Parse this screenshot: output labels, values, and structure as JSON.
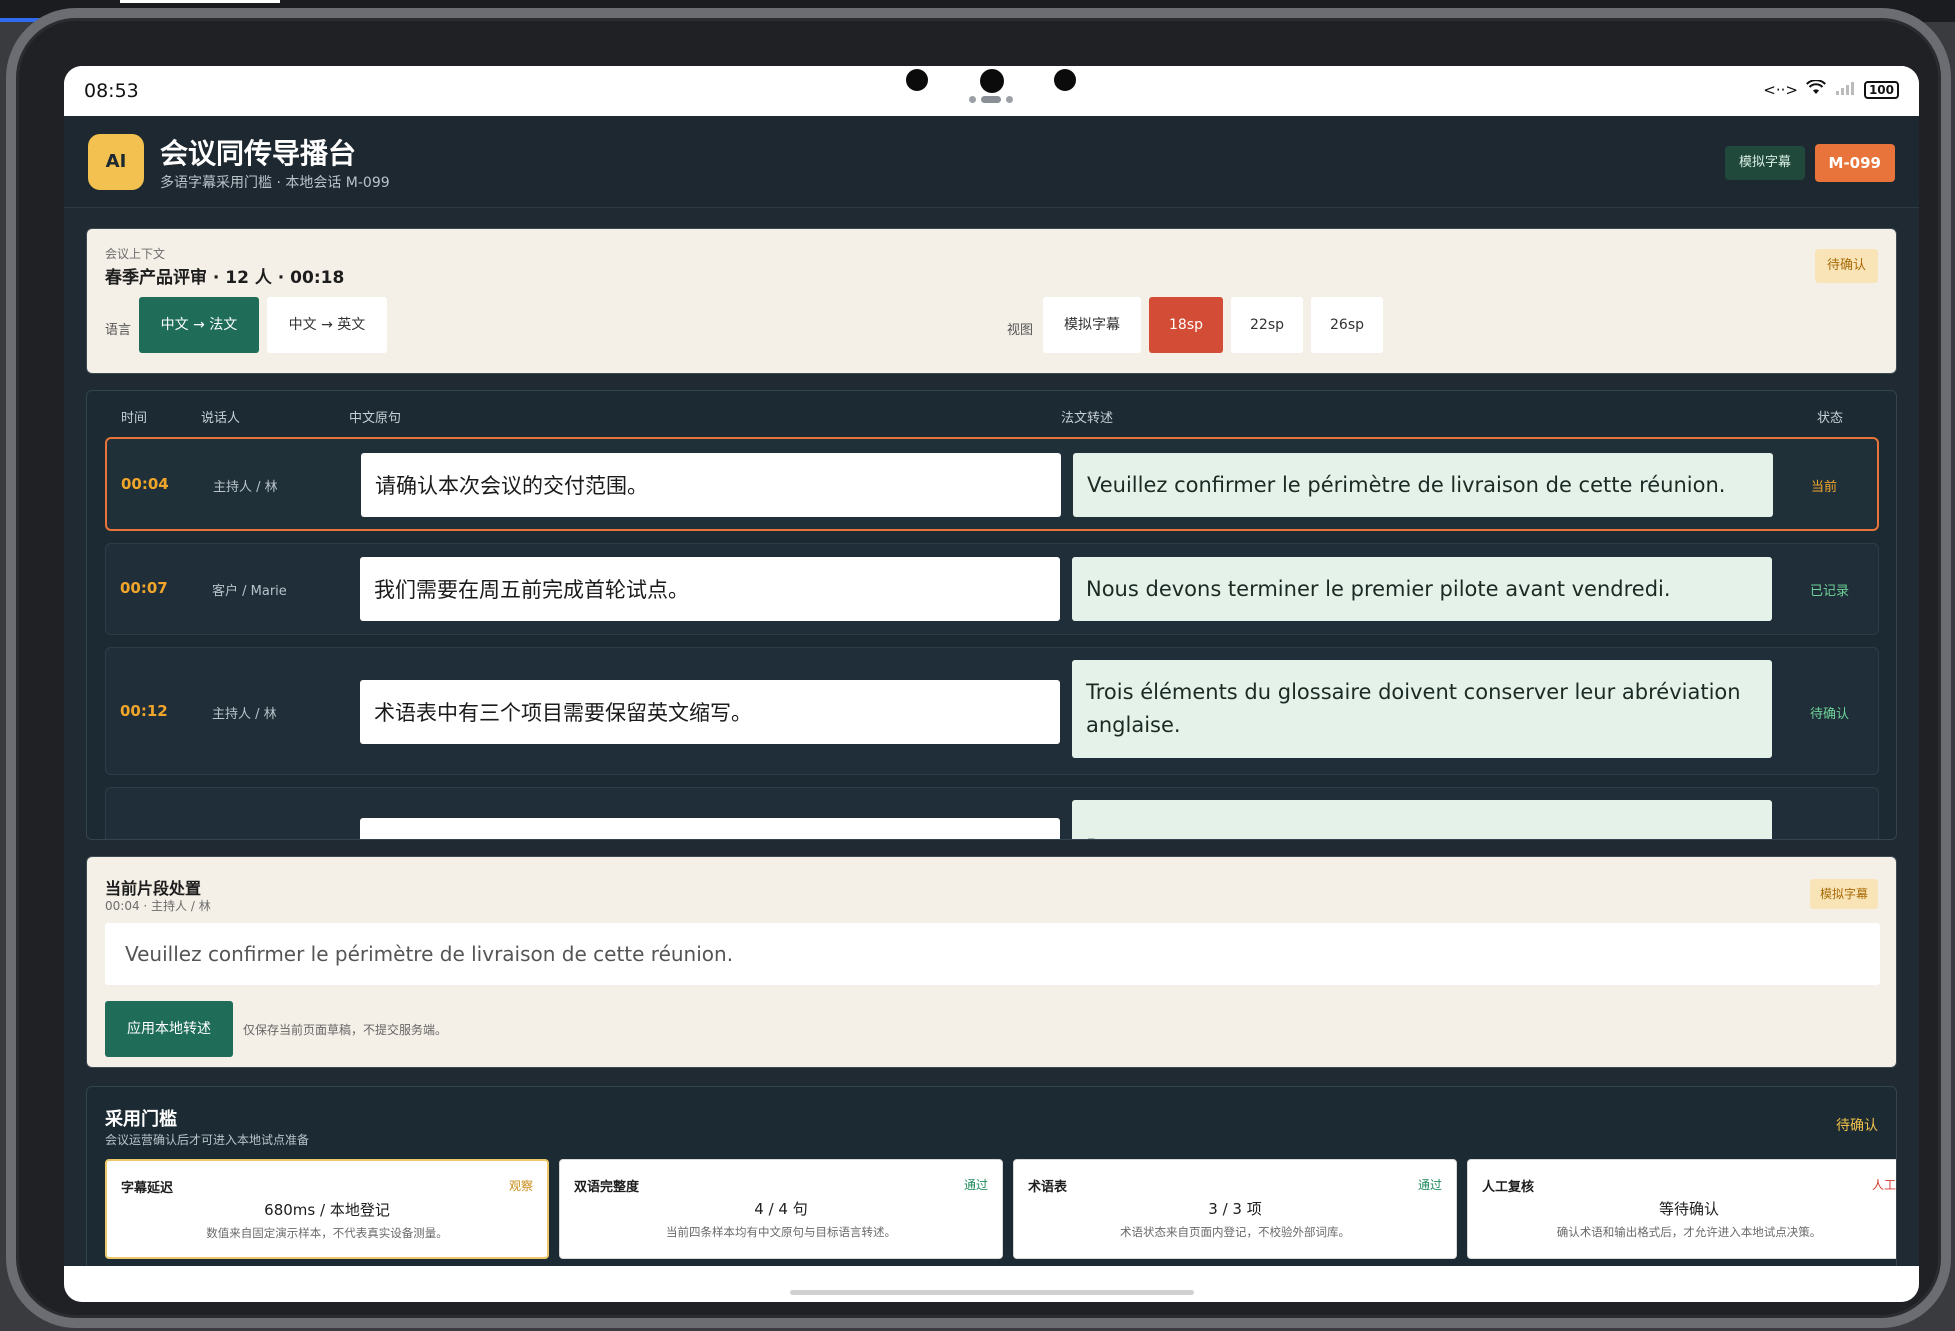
{
  "status": {
    "time": "08:53",
    "network": "<··>",
    "wifi": "wifi-icon",
    "signal": "signal-icon",
    "battery": "100"
  },
  "header": {
    "logo": "AI",
    "title": "会议同传导播台",
    "subtitle": "多语字幕采用门槛 · 本地会话 M-099",
    "badge_sim": "模拟字幕",
    "badge_id": "M-099"
  },
  "context": {
    "small_label": "会议上下文",
    "title": "春季产品评审 · 12 人 · 00:18",
    "pending": "待确认",
    "lang_label": "语言",
    "lang_options": [
      "中文 → 法文",
      "中文 → 英文"
    ],
    "lang_selected": "中文 → 法文",
    "view_label": "视图",
    "view_options": [
      "模拟字幕",
      "18sp",
      "22sp",
      "26sp"
    ],
    "view_selected": "18sp"
  },
  "table": {
    "headers": [
      "时间",
      "说话人",
      "中文原句",
      "法文转述",
      "状态"
    ],
    "rows": [
      {
        "time": "00:04",
        "speaker": "主持人 / 林",
        "zh": "请确认本次会议的交付范围。",
        "fr": "Veuillez confirmer le périmètre de livraison de cette réunion.",
        "status": "当前"
      },
      {
        "time": "00:07",
        "speaker": "客户 / Marie",
        "zh": "我们需要在周五前完成首轮试点。",
        "fr": "Nous devons terminer le premier pilote avant vendredi.",
        "status": "已记录"
      },
      {
        "time": "00:12",
        "speaker": "主持人 / 林",
        "zh": "术语表中有三个项目需要保留英文缩写。",
        "fr": "Trois éléments du glossaire doivent conserver leur abréviation anglaise.",
        "status": "待确认"
      },
      {
        "time": "",
        "speaker": "",
        "zh": "",
        "fr": "P…",
        "status": ""
      }
    ]
  },
  "segment": {
    "title": "当前片段处置",
    "meta": "00:04 · 主持人 / 林",
    "badge": "模拟字幕",
    "field_value": "Veuillez confirmer le périmètre de livraison de cette réunion.",
    "apply_label": "应用本地转述",
    "note": "仅保存当前页面草稿，不提交服务端。"
  },
  "gate": {
    "title": "采用门槛",
    "subtitle": "会议运营确认后才可进入本地试点准备",
    "pending": "待确认",
    "items": [
      {
        "name": "字幕延迟",
        "state": "观察",
        "value": "680ms / 本地登记",
        "desc": "数值来自固定演示样本，不代表真实设备测量。"
      },
      {
        "name": "双语完整度",
        "state": "通过",
        "value": "4 / 4 句",
        "desc": "当前四条样本均有中文原句与目标语言转述。"
      },
      {
        "name": "术语表",
        "state": "通过",
        "value": "3 / 3 项",
        "desc": "术语状态来自页面内登记，不校验外部词库。"
      },
      {
        "name": "人工复核",
        "state": "人工",
        "value": "等待确认",
        "desc": "确认术语和输出格式后，才允许进入本地试点决策。"
      }
    ]
  },
  "colors": {
    "accent_orange": "#e8743b",
    "accent_green": "#1f6d59",
    "accent_red": "#d24c36",
    "time_yellow": "#f0a52b",
    "status_current": "#f0a52b",
    "status_recorded": "#6fd39a",
    "status_pending": "#6fd39a",
    "gate_observe": "#c98a14",
    "gate_pass": "#1f8a5c",
    "gate_manual": "#d63a2e"
  }
}
